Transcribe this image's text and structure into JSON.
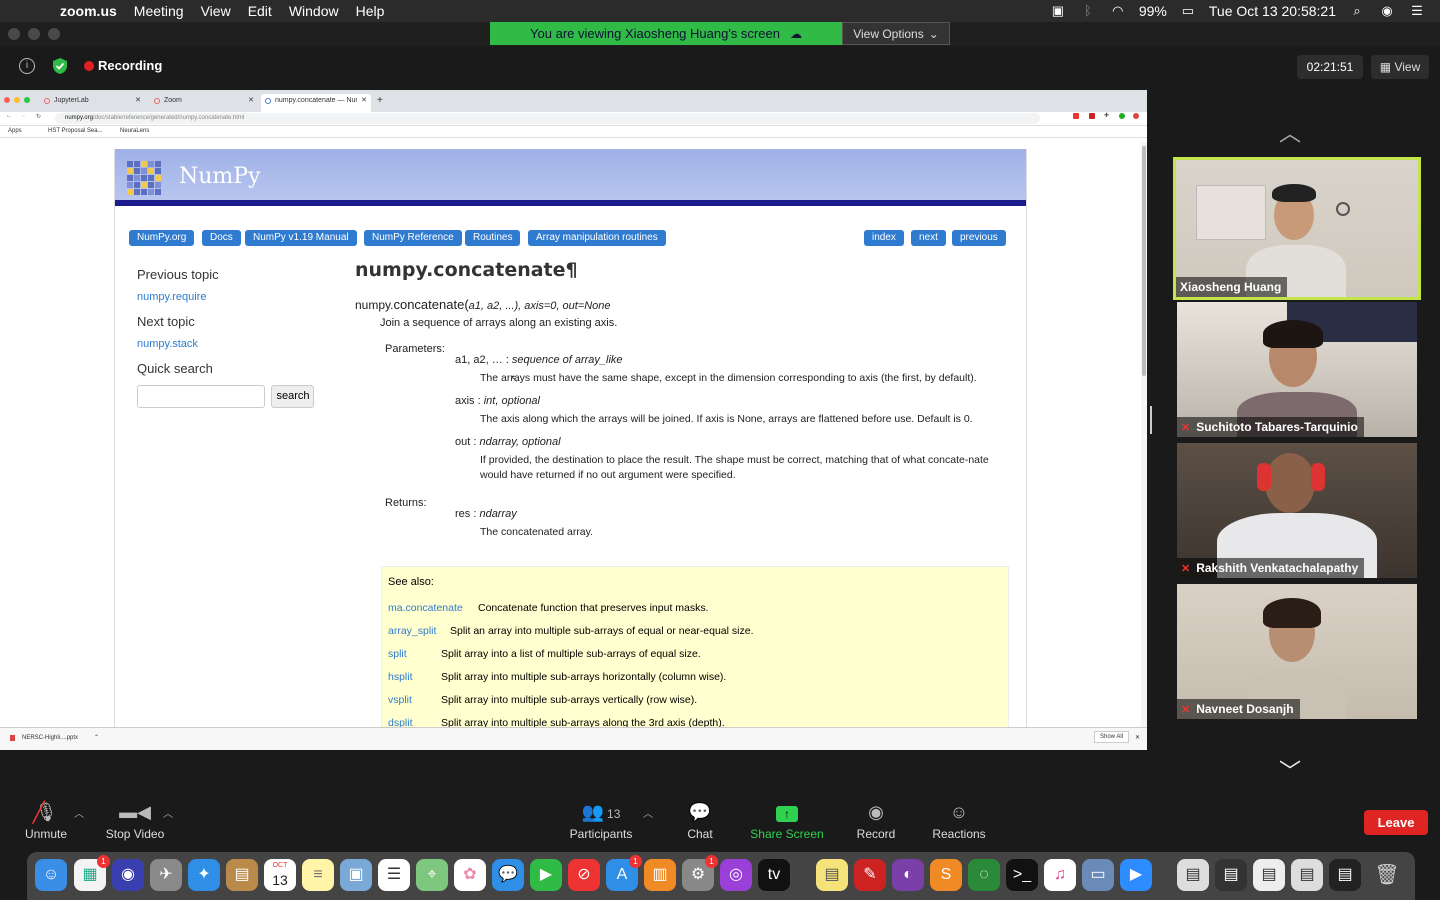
{
  "menubar": {
    "app": "zoom.us",
    "items": [
      "Meeting",
      "View",
      "Edit",
      "Window",
      "Help"
    ],
    "battery": "99%",
    "clock": "Tue Oct 13  20:58:21"
  },
  "share_banner": {
    "text": "You are viewing Xiaosheng Huang's screen",
    "view_options": "View Options"
  },
  "topbar": {
    "recording_label": "Recording",
    "timer": "02:21:51",
    "view_label": "View"
  },
  "browser": {
    "tabs": [
      {
        "label": "JupyterLab"
      },
      {
        "label": "Zoom"
      },
      {
        "label": "numpy.concatenate — NumPy"
      }
    ],
    "url_host": "numpy.org",
    "url_path": "/doc/stable/reference/generated/numpy.concatenate.html",
    "bookmarks": [
      "Apps",
      "HST Proposal Sea...",
      "NeuraLens"
    ],
    "download_file": "NERSC-Highli....pptx",
    "show_all": "Show All"
  },
  "numpy_page": {
    "brand": "NumPy",
    "breadcrumbs": [
      "NumPy.org",
      "Docs",
      "NumPy v1.19 Manual",
      "NumPy Reference",
      "Routines",
      "Array manipulation routines"
    ],
    "nav": [
      "index",
      "next",
      "previous"
    ],
    "sidebar": {
      "prev_heading": "Previous topic",
      "prev_link": "numpy.require",
      "next_heading": "Next topic",
      "next_link": "numpy.stack",
      "search_heading": "Quick search",
      "search_button": "search"
    },
    "title": "numpy.concatenate¶",
    "signature_prefix": "numpy.",
    "signature_name": "concatenate",
    "signature_args": "a1, a2, ...), axis=0, out=None",
    "summary": "Join a sequence of arrays along an existing axis.",
    "parameters_label": "Parameters:",
    "params": [
      {
        "name": "a1, a2, …",
        "type": "sequence of array_like",
        "desc": "The arrays must have the same shape, except in the dimension corresponding to axis (the first, by default)."
      },
      {
        "name": "axis",
        "type": "int, optional",
        "desc": "The axis along which the arrays will be joined. If axis is None, arrays are flattened before use. Default is 0."
      },
      {
        "name": "out",
        "type": "ndarray, optional",
        "desc": "If provided, the destination to place the result. The shape must be correct, matching that of what concate-nate would have returned if no out argument were specified."
      }
    ],
    "returns_label": "Returns:",
    "returns": {
      "name": "res",
      "type": "ndarray",
      "desc": "The concatenated array."
    },
    "see_also_title": "See also:",
    "see_also": [
      {
        "fn": "ma.concatenate",
        "desc": "Concatenate function that preserves input masks."
      },
      {
        "fn": "array_split",
        "desc": "Split an array into multiple sub-arrays of equal or near-equal size."
      },
      {
        "fn": "split",
        "desc": "Split array into a list of multiple sub-arrays of equal size."
      },
      {
        "fn": "hsplit",
        "desc": "Split array into multiple sub-arrays horizontally (column wise)."
      },
      {
        "fn": "vsplit",
        "desc": "Split array into multiple sub-arrays vertically (row wise)."
      },
      {
        "fn": "dsplit",
        "desc": "Split array into multiple sub-arrays along the 3rd axis (depth)."
      }
    ]
  },
  "participants": [
    {
      "name": "Xiaosheng Huang",
      "muted": false,
      "active": true
    },
    {
      "name": "Suchitoto Tabares-Tarquinio",
      "muted": true,
      "active": false
    },
    {
      "name": "Rakshith Venkatachalapathy",
      "muted": true,
      "active": false
    },
    {
      "name": "Navneet Dosanjh",
      "muted": true,
      "active": false
    }
  ],
  "toolbar": {
    "unmute": "Unmute",
    "stop_video": "Stop Video",
    "participants": "Participants",
    "participant_count": "13",
    "chat": "Chat",
    "share_screen": "Share Screen",
    "record": "Record",
    "reactions": "Reactions",
    "leave": "Leave"
  },
  "dock": {
    "calendar_month": "OCT",
    "calendar_day": "13",
    "badge_values": [
      "1",
      "1",
      "1"
    ]
  },
  "colors": {
    "share_green": "#2fbb45",
    "active_speaker": "#c4e54a",
    "leave_red": "#e02424",
    "numpy_blue": "#2f7bd0"
  }
}
